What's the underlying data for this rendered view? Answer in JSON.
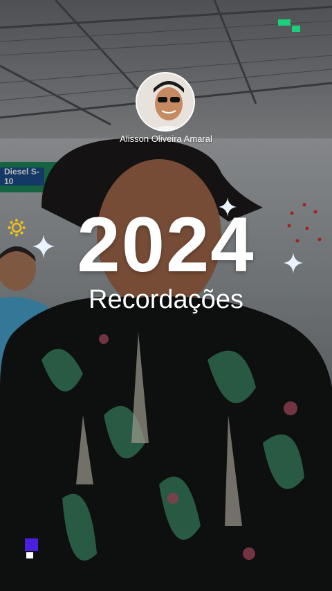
{
  "story": {
    "user_name": "Alisson Oliveira Amaral",
    "year": "2024",
    "subtitle": "Recordações",
    "background_sign_text": "Diesel S-10",
    "brand_colors": {
      "green_mark": "#19d17a",
      "purple_mark": "#4a1fe0"
    },
    "icons": {
      "sparkles": [
        "sparkle-icon",
        "sparkle-icon",
        "sparkle-icon"
      ],
      "sun": "sun-icon"
    }
  }
}
